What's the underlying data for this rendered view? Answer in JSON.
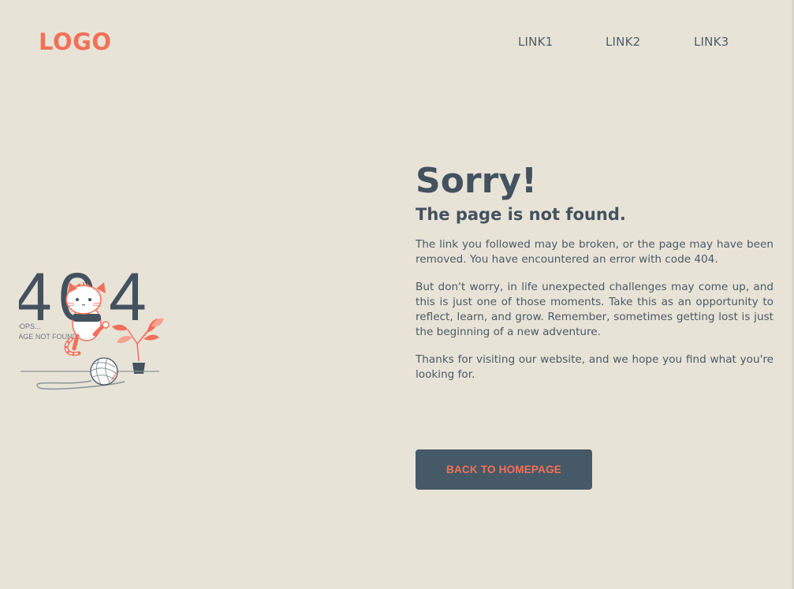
{
  "header": {
    "logo": "LOGO",
    "nav": {
      "link1": "LINK1",
      "link2": "LINK2",
      "link3": "LINK3"
    }
  },
  "illustration": {
    "digits_left": "4",
    "digits_middle": "0",
    "digits_right": "4",
    "caption_line1": "OOPS...",
    "caption_line2": "PAGE NOT FOUND"
  },
  "main": {
    "title": "Sorry!",
    "subtitle": "The page is not found.",
    "paragraphs": [
      "The link you followed may be broken, or the page may have been removed. You have encountered an error with code 404.",
      "But don't worry, in life unexpected challenges may come up, and this is just one of those moments. Take this as an opportunity to reflect, learn, and grow. Remember, sometimes getting lost is just the beginning of a new adventure.",
      "Thanks for visiting our website, and we hope you find what you're looking for."
    ],
    "button_label": "BACK TO HOMEPAGE"
  },
  "colors": {
    "background": "#e8e3d7",
    "accent": "#f27059",
    "text": "#44525f",
    "button": "#465966"
  }
}
